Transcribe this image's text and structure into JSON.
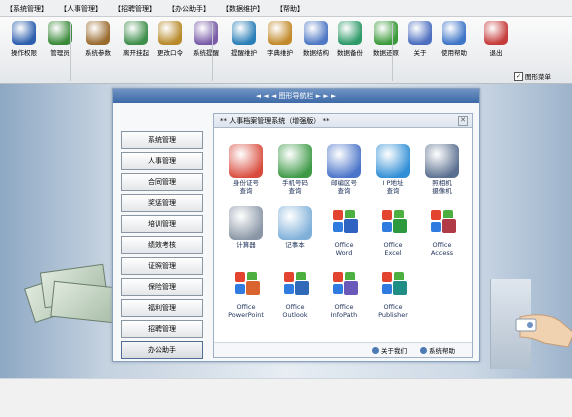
{
  "menu": [
    "【系统管理】",
    "【人事管理】",
    "【招聘管理】",
    "【办公助手】",
    "【数据维护】",
    "【帮助】"
  ],
  "toolbar": [
    {
      "label": "操作权限",
      "icon": "users-key-icon"
    },
    {
      "label": "管理员",
      "icon": "admin-icon"
    },
    {
      "label": "系统参数",
      "icon": "tools-icon"
    },
    {
      "label": "离开挂起",
      "icon": "leave-user-icon"
    },
    {
      "label": "更改口令",
      "icon": "key-icon"
    },
    {
      "label": "系统提醒",
      "icon": "group-alert-icon"
    },
    {
      "label": "提醒维护",
      "icon": "reminder-edit-icon"
    },
    {
      "label": "字典维护",
      "icon": "dictionary-icon"
    },
    {
      "label": "数据结构",
      "icon": "db-structure-icon"
    },
    {
      "label": "数据备份",
      "icon": "backup-icon"
    },
    {
      "label": "数据还原",
      "icon": "restore-icon"
    },
    {
      "label": "关于",
      "icon": "about-icon"
    },
    {
      "label": "使用帮助",
      "icon": "help-icon"
    },
    {
      "label": "退出",
      "icon": "exit-icon"
    }
  ],
  "toolbar_check": {
    "label": "图形菜单",
    "checked": "✓"
  },
  "panel_title": "◄ ◄ ◄  图形导航栏  ► ► ►",
  "sidebar": [
    "系统管理",
    "人事管理",
    "合同管理",
    "奖惩管理",
    "培训管理",
    "绩效考核",
    "证照管理",
    "保险管理",
    "福利管理",
    "招聘管理",
    "办公助手"
  ],
  "sidebar_active": 10,
  "content_title": "** 人事档案管理系统（增强版） **",
  "content_close": "✕",
  "grid": [
    {
      "label": "身份证号\n查询",
      "icon": "id-card-query-icon",
      "color": "#d94c3d"
    },
    {
      "label": "手机号码\n查询",
      "icon": "mobile-query-icon",
      "color": "#3e9a47"
    },
    {
      "label": "邮编区号\n查询",
      "icon": "postcode-query-icon",
      "color": "#4a74c9"
    },
    {
      "label": "I P地址\n查询",
      "icon": "ip-query-icon",
      "color": "#2f8ed6"
    },
    {
      "label": "照相机\n摄像机",
      "icon": "camera-icon",
      "color": "#5a6f8f"
    },
    {
      "label": "计算器",
      "icon": "calculator-icon",
      "color": "#8a96a6"
    },
    {
      "label": "记事本",
      "icon": "notepad-icon",
      "color": "#7fb0d9"
    },
    {
      "label": "Office\nWord",
      "icon": "office-word-icon",
      "color": "#2f63c2"
    },
    {
      "label": "Office\nExcel",
      "icon": "office-excel-icon",
      "color": "#2e9a3e"
    },
    {
      "label": "Office\nAccess",
      "icon": "office-access-icon",
      "color": "#b03a46"
    },
    {
      "label": "Office\nPowerPoint",
      "icon": "office-powerpoint-icon",
      "color": "#d9642e"
    },
    {
      "label": "Office\nOutlook",
      "icon": "office-outlook-icon",
      "color": "#2f69b8"
    },
    {
      "label": "Office\nInfoPath",
      "icon": "office-infopath-icon",
      "color": "#6a59b8"
    },
    {
      "label": "Office\nPublisher",
      "icon": "office-publisher-icon",
      "color": "#1f8f86"
    }
  ],
  "footer": {
    "about": "关于我们",
    "help": "系统帮助"
  }
}
